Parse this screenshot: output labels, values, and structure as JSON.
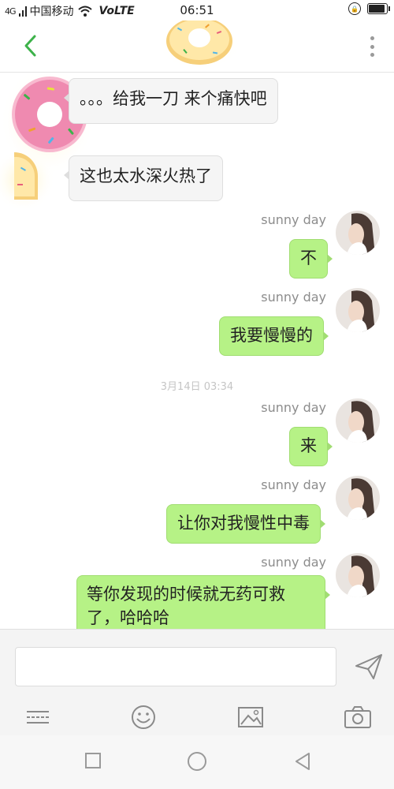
{
  "status_bar": {
    "signal": "4G",
    "carrier": "中国移动",
    "volte": "VoLTE",
    "time": "06:51",
    "battery_level": 0.85
  },
  "header": {
    "back_icon": "chevron-left-icon",
    "menu_icon": "more-vertical-icon",
    "avatar_icon": "donut-avatar-icon"
  },
  "messages": [
    {
      "direction": "in",
      "text": "。。。给我一刀 来个痛快吧"
    },
    {
      "direction": "in",
      "text": "这也太水深火热了"
    },
    {
      "direction": "out",
      "sender": "sunny day",
      "text": "不"
    },
    {
      "direction": "out",
      "sender": "sunny day",
      "text": "我要慢慢的"
    },
    {
      "type": "timestamp",
      "text": "3月14日 03:34"
    },
    {
      "direction": "out",
      "sender": "sunny day",
      "text": "来"
    },
    {
      "direction": "out",
      "sender": "sunny day",
      "text": "让你对我慢性中毒"
    },
    {
      "direction": "out",
      "sender": "sunny day",
      "text": "等你发现的时候就无药可救了，哈哈哈"
    }
  ],
  "composer": {
    "input_value": "",
    "send_icon": "send-icon",
    "tools": [
      "keyboard-icon",
      "emoji-icon",
      "image-icon",
      "camera-icon"
    ]
  },
  "nav_bar": {
    "buttons": [
      "recent-apps-icon",
      "home-icon",
      "back-triangle-icon"
    ]
  },
  "colors": {
    "accent_green": "#3db24a",
    "outgoing_bubble": "#b6f286",
    "incoming_bubble": "#f5f5f5"
  }
}
